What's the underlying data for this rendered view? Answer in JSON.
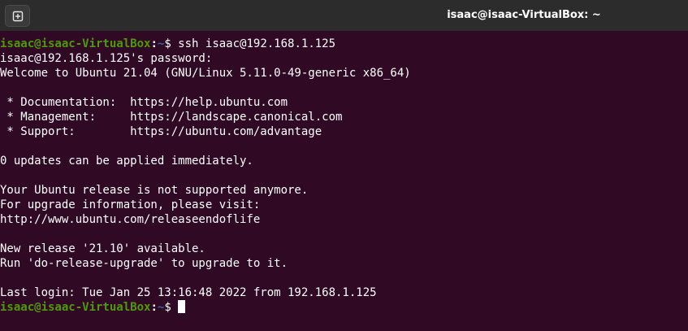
{
  "window": {
    "title": "isaac@isaac-VirtualBox: ~"
  },
  "toolbar": {
    "new_tab_icon": "new-tab-icon"
  },
  "colors": {
    "background": "#300a24",
    "titlebar": "#2c2c2c",
    "prompt_user": "#4e9a06",
    "prompt_path": "#3465a4",
    "text": "#ffffff"
  },
  "prompt": {
    "user_host": "isaac@isaac-VirtualBox",
    "separator": ":",
    "path": "~",
    "symbol": "$ "
  },
  "terminal": {
    "command": "ssh isaac@192.168.1.125",
    "output": [
      "isaac@192.168.1.125's password:",
      "Welcome to Ubuntu 21.04 (GNU/Linux 5.11.0-49-generic x86_64)",
      "",
      " * Documentation:  https://help.ubuntu.com",
      " * Management:     https://landscape.canonical.com",
      " * Support:        https://ubuntu.com/advantage",
      "",
      "0 updates can be applied immediately.",
      "",
      "Your Ubuntu release is not supported anymore.",
      "For upgrade information, please visit:",
      "http://www.ubuntu.com/releaseendoflife",
      "",
      "New release '21.10' available.",
      "Run 'do-release-upgrade' to upgrade to it.",
      "",
      "Last login: Tue Jan 25 13:16:48 2022 from 192.168.1.125"
    ]
  }
}
